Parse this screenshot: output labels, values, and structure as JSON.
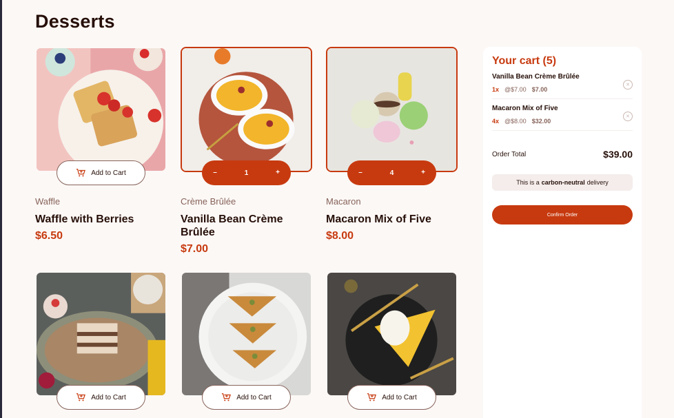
{
  "page": {
    "title": "Desserts"
  },
  "products": [
    {
      "category": "Waffle",
      "name": "Waffle with Berries",
      "price": "$6.50",
      "button": "Add to Cart"
    },
    {
      "category": "Crème Brûlée",
      "name": "Vanilla Bean Crème Brûlée",
      "price": "$7.00",
      "quantity": "1",
      "minus": "–",
      "plus": "+"
    },
    {
      "category": "Macaron",
      "name": "Macaron Mix of Five",
      "price": "$8.00",
      "quantity": "4",
      "minus": "–",
      "plus": "+"
    },
    {
      "button": "Add to Cart"
    },
    {
      "button": "Add to Cart"
    },
    {
      "button": "Add to Cart"
    }
  ],
  "cart": {
    "title": "Your cart (5)",
    "items": [
      {
        "name": "Vanilla Bean Crème Brûlée",
        "qty": "1x",
        "unit": "@$7.00",
        "total": "$7.00"
      },
      {
        "name": "Macaron Mix of Five",
        "qty": "4x",
        "unit": "@$8.00",
        "total": "$32.00"
      }
    ],
    "order_total_label": "Order Total",
    "order_total_value": "$39.00",
    "carbon_prefix": "This is a",
    "carbon_bold": "carbon-neutral",
    "carbon_suffix": "delivery",
    "confirm_label": "Confirm Order"
  },
  "colors": {
    "accent": "#c73a0f",
    "text": "#260f08",
    "muted": "#87635a",
    "bg": "#fcf8f6"
  }
}
